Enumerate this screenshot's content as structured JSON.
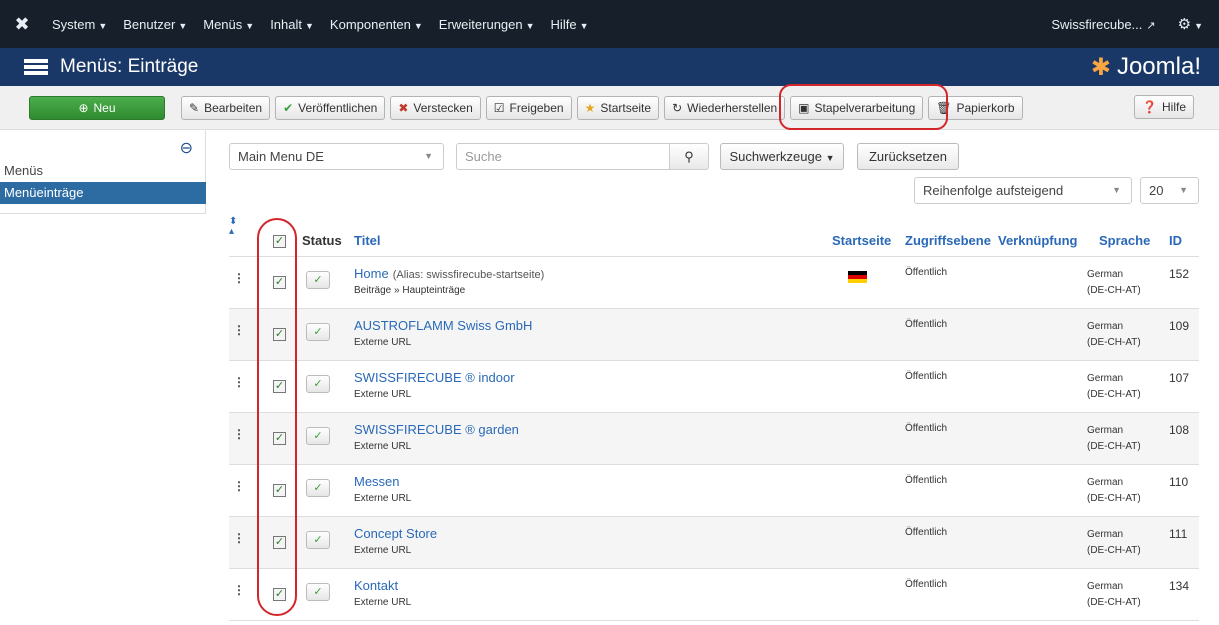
{
  "topnav": {
    "menus": [
      "System",
      "Benutzer",
      "Menüs",
      "Inhalt",
      "Komponenten",
      "Erweiterungen",
      "Hilfe"
    ],
    "site_name": "Swissfirecube..."
  },
  "header": {
    "title": "Menüs: Einträge",
    "brand": "Joomla!"
  },
  "toolbar": {
    "new": "Neu",
    "edit": "Bearbeiten",
    "publish": "Veröffentlichen",
    "unpublish": "Verstecken",
    "checkin": "Freigeben",
    "home": "Startseite",
    "rebuild": "Wiederherstellen",
    "batch": "Stapelverarbeitung",
    "trash": "Papierkorb",
    "help": "Hilfe"
  },
  "sidebar": {
    "items": [
      "Menüs",
      "Menüeinträge"
    ],
    "active": "Menüeinträge"
  },
  "filters": {
    "menu_select": "Main Menu DE",
    "search_placeholder": "Suche",
    "search_tools": "Suchwerkzeuge",
    "reset": "Zurücksetzen",
    "ordering": "Reihenfolge aufsteigend",
    "limit": "20"
  },
  "table": {
    "headers": {
      "status": "Status",
      "title": "Titel",
      "home": "Startseite",
      "access": "Zugriffsebene",
      "association": "Verknüpfung",
      "language": "Sprache",
      "id": "ID"
    },
    "rows": [
      {
        "title": "Home",
        "alias": "(Alias: swissfirecube-startseite)",
        "type": "Beiträge » Haupteinträge",
        "home": true,
        "access": "Öffentlich",
        "lang1": "German",
        "lang2": "(DE-CH-AT)",
        "id": "152"
      },
      {
        "title": "AUSTROFLAMM Swiss GmbH",
        "alias": "",
        "type": "Externe URL",
        "home": false,
        "access": "Öffentlich",
        "lang1": "German",
        "lang2": "(DE-CH-AT)",
        "id": "109"
      },
      {
        "title": "SWISSFIRECUBE ® indoor",
        "alias": "",
        "type": "Externe URL",
        "home": false,
        "access": "Öffentlich",
        "lang1": "German",
        "lang2": "(DE-CH-AT)",
        "id": "107"
      },
      {
        "title": "SWISSFIRECUBE ® garden",
        "alias": "",
        "type": "Externe URL",
        "home": false,
        "access": "Öffentlich",
        "lang1": "German",
        "lang2": "(DE-CH-AT)",
        "id": "108"
      },
      {
        "title": "Messen",
        "alias": "",
        "type": "Externe URL",
        "home": false,
        "access": "Öffentlich",
        "lang1": "German",
        "lang2": "(DE-CH-AT)",
        "id": "110"
      },
      {
        "title": "Concept Store",
        "alias": "",
        "type": "Externe URL",
        "home": false,
        "access": "Öffentlich",
        "lang1": "German",
        "lang2": "(DE-CH-AT)",
        "id": "111"
      },
      {
        "title": "Kontakt",
        "alias": "",
        "type": "Externe URL",
        "home": false,
        "access": "Öffentlich",
        "lang1": "German",
        "lang2": "(DE-CH-AT)",
        "id": "134"
      }
    ]
  },
  "colors": {
    "topnav": "#17202a",
    "header": "#1a3867",
    "link": "#2a69b8",
    "new_button": "#3c9e3c",
    "highlight_ring": "#d3262a",
    "sidebar_active": "#2d6ca2"
  }
}
